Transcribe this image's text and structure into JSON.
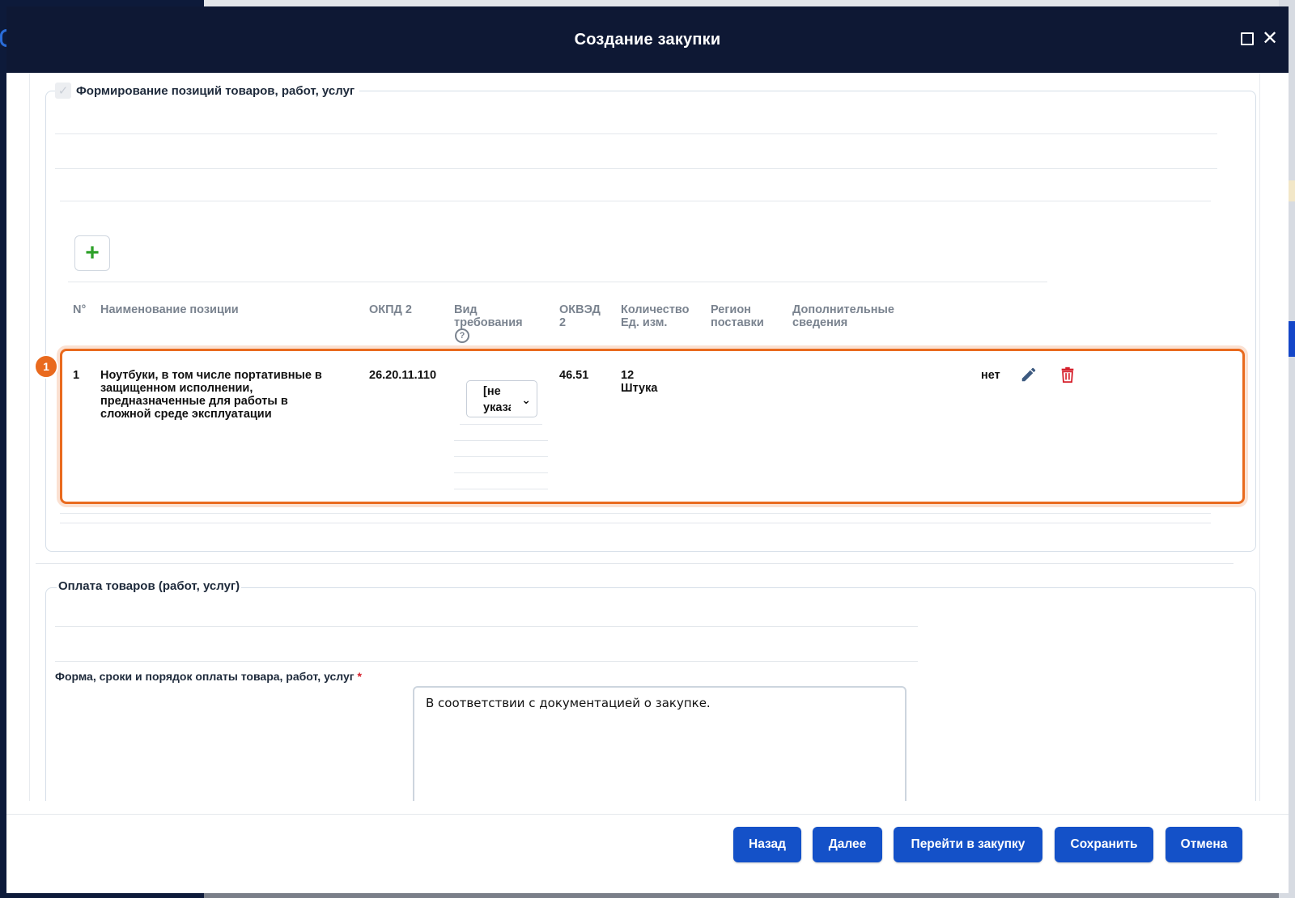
{
  "modal": {
    "title": "Создание закупки"
  },
  "positions_section": {
    "legend": "Формирование позиций товаров, работ, услуг",
    "columns": {
      "num": "N°",
      "name": "Наименование позиции",
      "okpd": "ОКПД 2",
      "req_type_1": "Вид",
      "req_type_2": "требования",
      "okved_1": "ОКВЭД",
      "okved_2": "2",
      "qty_1": "Количество",
      "qty_2": "Ед. изм.",
      "region_1": "Регион",
      "region_2": "поставки",
      "extra_1": "Дополнительные",
      "extra_2": "сведения"
    },
    "row": {
      "badge": "1",
      "num": "1",
      "name_l1": "Ноутбуки, в том числе портативные в",
      "name_l2": "защищенном исполнении,",
      "name_l3": "предназначенные для работы в",
      "name_l4": "сложной среде эксплуатации",
      "okpd": "26.20.11.110",
      "req_type_value": "[не указано]",
      "okved": "46.51",
      "qty": "12",
      "unit": "Штука",
      "extra": "нет"
    }
  },
  "payment_section": {
    "legend": "Оплата товаров (работ, услуг)",
    "field_label": "Форма, сроки и порядок оплаты товара, работ, услуг",
    "required_mark": "*",
    "field_value": "В соответствии с документацией о закупке."
  },
  "footer": {
    "back": "Назад",
    "next": "Далее",
    "goto": "Перейти в закупку",
    "save": "Сохранить",
    "cancel": "Отмена"
  },
  "colors": {
    "header_bg": "#0e1834",
    "primary_button": "#1451c8",
    "highlight": "#e96a1e",
    "add_icon": "#2fa12a",
    "delete_icon": "#d6202c"
  }
}
